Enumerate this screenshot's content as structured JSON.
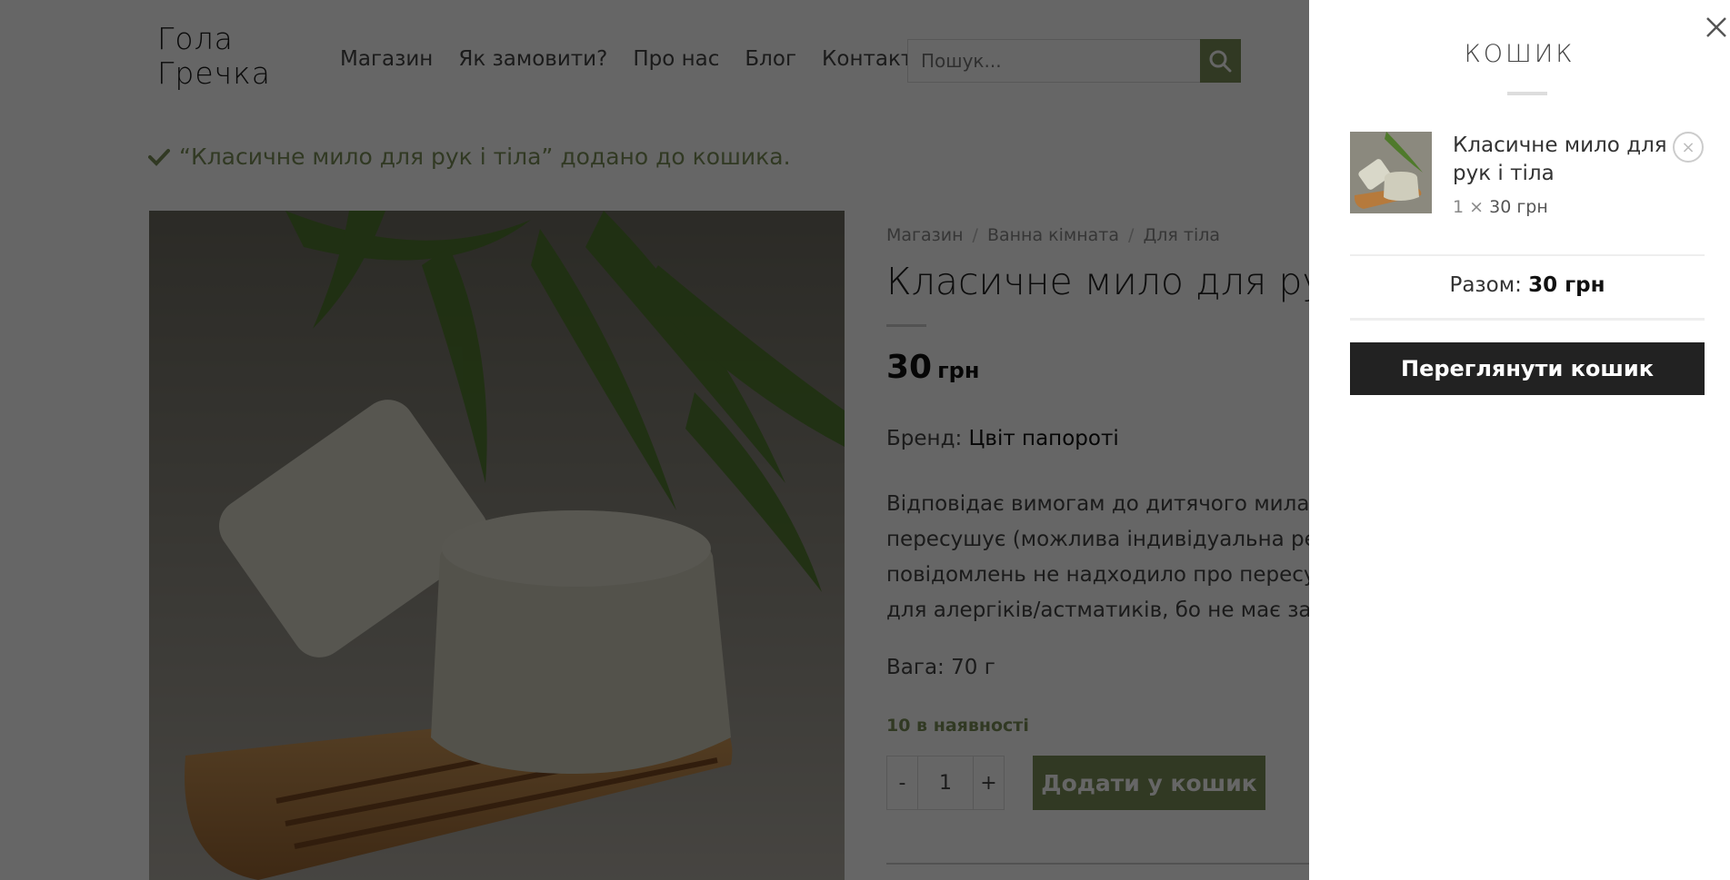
{
  "header": {
    "logo_line1": "Гола",
    "logo_line2": "Гречка",
    "nav": [
      {
        "label": "Магазин"
      },
      {
        "label": "Як замовити?"
      },
      {
        "label": "Про нас"
      },
      {
        "label": "Блог"
      },
      {
        "label": "Контакти"
      }
    ],
    "search": {
      "placeholder": "Пошук...",
      "value": ""
    },
    "social_icon": "facebook-icon"
  },
  "notice": {
    "icon": "checkmark-icon",
    "text": "“Класичне мило для рук і тіла” додано до кошика."
  },
  "product": {
    "image_icon": "product-image",
    "breadcrumb": [
      "Магазин",
      "Ванна кімната",
      "Для тіла"
    ],
    "breadcrumb_sep": "/",
    "title": "Класичне мило для рук і тіла",
    "price_value": "30",
    "price_currency": "грн",
    "brand_label": "Бренд:",
    "brand_value": "Цвіт папороті",
    "description": "Відповідає вимогам до дитячого мила. Добре очищає, не пересушує (можлива індивідуальна реакція шкіри, поки повідомлень не надходило про пересушування), підходить для алергіків/астматиків, бо не має запаху.",
    "weight": "Вага: 70 г",
    "stock": "10 в наявності",
    "quantity": {
      "minus": "-",
      "value": "1",
      "plus": "+"
    },
    "add_to_cart": "Додати у кошик"
  },
  "cart": {
    "title": "КОШИК",
    "close_icon": "close-icon",
    "items": [
      {
        "name": "Класичне мило для рук і тіла",
        "qty": "1 ×",
        "price": "30 грн",
        "remove": "×"
      }
    ],
    "subtotal_label": "Разом:",
    "subtotal_value": "30 грн",
    "view_cart": "Переглянути кошик"
  },
  "colors": {
    "accent": "#7a8f59",
    "dark_button": "#222222",
    "overlay": "rgba(0,0,0,0.6)"
  }
}
